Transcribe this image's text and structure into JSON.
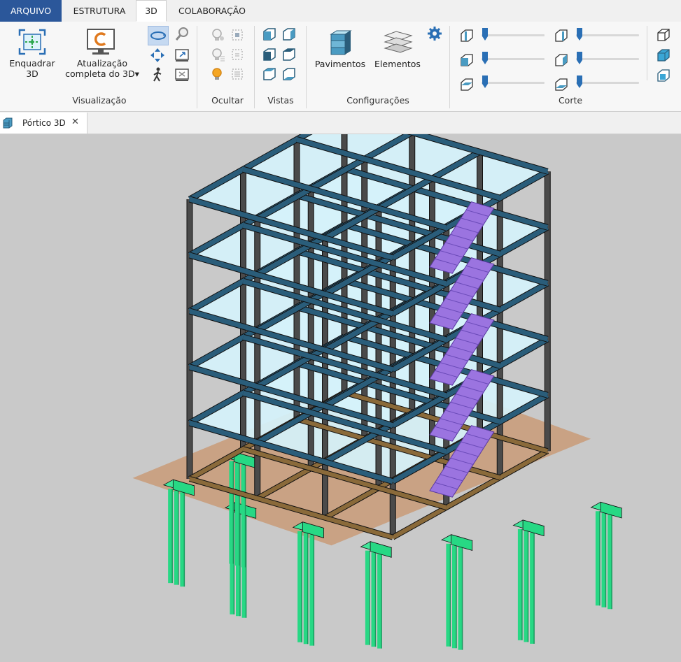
{
  "menu": {
    "tabs": [
      "ARQUIVO",
      "ESTRUTURA",
      "3D",
      "COLABORAÇÃO"
    ],
    "active_tab": "3D"
  },
  "ribbon": {
    "visualizacao": {
      "label": "Visualização",
      "enquadrar": {
        "line1": "Enquadrar",
        "line2": "3D"
      },
      "atualizacao": {
        "line1": "Atualização",
        "line2": "completa do 3D▾"
      }
    },
    "ocultar": {
      "label": "Ocultar"
    },
    "vistas": {
      "label": "Vistas"
    },
    "configuracoes": {
      "label": "Configurações",
      "pavimentos": "Pavimentos",
      "elementos": "Elementos"
    },
    "corte": {
      "label": "Corte",
      "sliders_left": [
        0.0,
        0.0,
        0.0
      ],
      "sliders_right": [
        0.0,
        0.0,
        0.0
      ]
    }
  },
  "document_tab": {
    "title": "Pórtico 3D",
    "close": "✕"
  },
  "colors": {
    "beam": "#2a5d7a",
    "slab": "#d6f3fb",
    "column": "#4a4a4a",
    "stair": "#9b74e0",
    "pile": "#27d884",
    "ground": "#c8824a",
    "accent": "#2b579a"
  }
}
